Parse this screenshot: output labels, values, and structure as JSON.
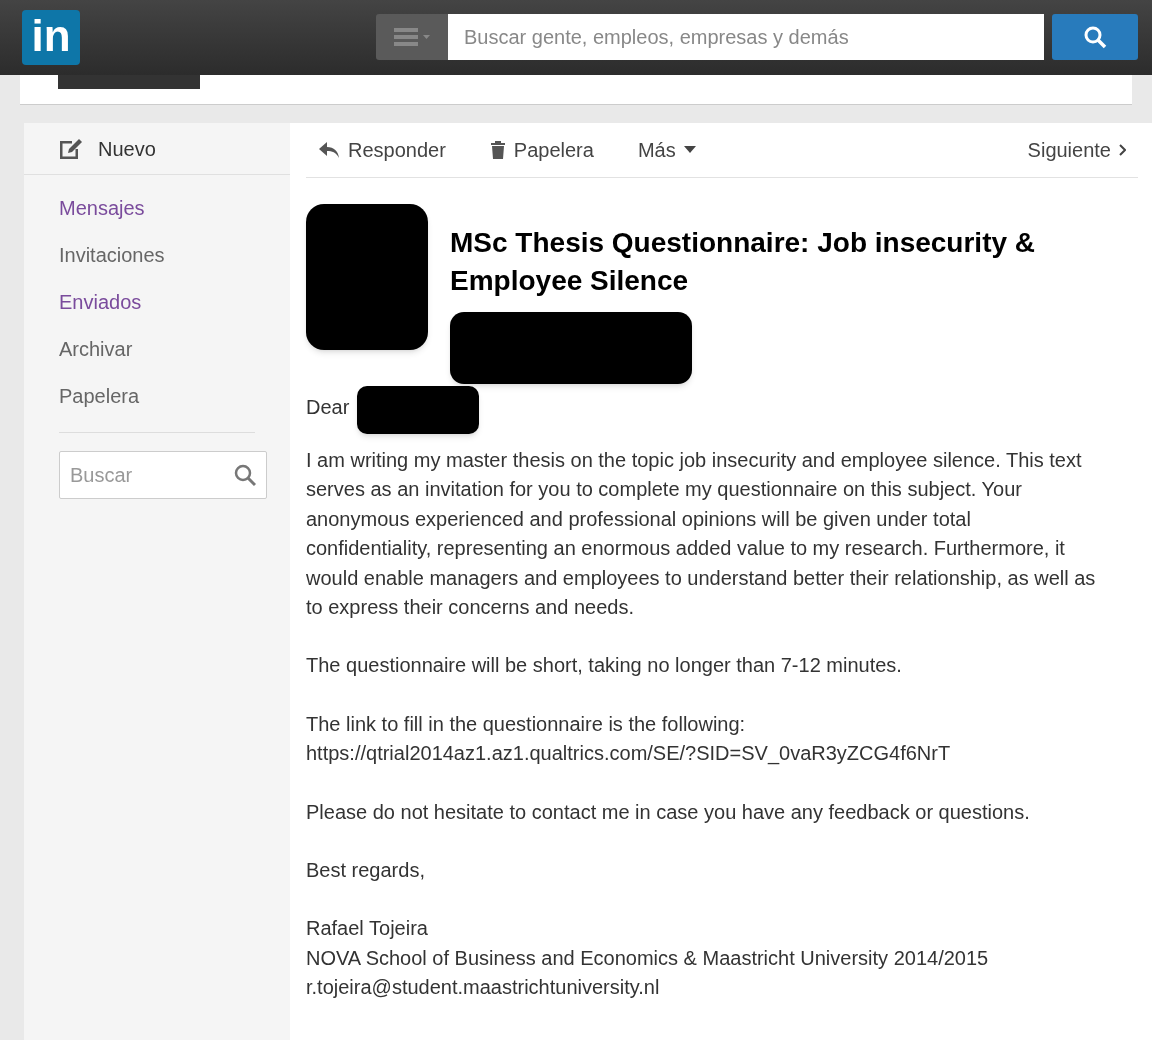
{
  "topbar": {
    "logo": "in",
    "search": {
      "placeholder": "Buscar gente, empleos, empresas y demás"
    }
  },
  "sidebar": {
    "compose": "Nuevo",
    "items": [
      {
        "label": "Mensajes",
        "visited": true
      },
      {
        "label": "Invitaciones",
        "visited": false
      },
      {
        "label": "Enviados",
        "visited": true
      },
      {
        "label": "Archivar",
        "visited": false
      },
      {
        "label": "Papelera",
        "visited": false
      }
    ],
    "search": {
      "placeholder": "Buscar"
    }
  },
  "toolbar": {
    "actions": [
      {
        "kind": "reply",
        "label": "Responder"
      },
      {
        "kind": "trash",
        "label": "Papelera"
      },
      {
        "kind": "more",
        "label": "Más"
      }
    ],
    "next": "Siguiente"
  },
  "message": {
    "subject": "MSc Thesis Questionnaire: Job insecurity & Employee Silence",
    "greeting": "Dear",
    "paragraphs": [
      [
        "I am writing my master thesis on the topic job insecurity and employee silence. This text serves as an invitation for you to complete my questionnaire on this subject. Your anonymous experienced and professional opinions will be given under total confidentiality, representing an enormous added value to my research. Furthermore, it would enable managers and employees to understand better their relationship, as well as to express their concerns and needs."
      ],
      [
        "The questionnaire will be short, taking no longer than 7-12 minutes."
      ],
      [
        "The link to fill in the questionnaire is the following:",
        "https://qtrial2014az1.az1.qualtrics.com/SE/?SID=SV_0vaR3yZCG4f6NrT"
      ],
      [
        "Please do not hesitate to contact me in case you have any feedback or questions."
      ],
      [
        "Best regards,"
      ],
      [
        "Rafael Tojeira",
        "NOVA School of Business and Economics & Maastricht University 2014/2015",
        "r.tojeira@student.maastrichtuniversity.nl"
      ]
    ]
  }
}
